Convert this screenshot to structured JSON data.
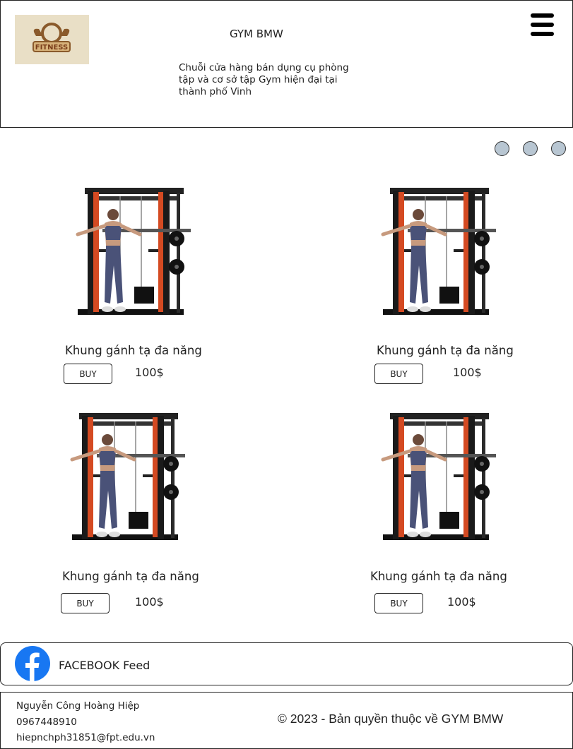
{
  "header": {
    "logo_text": "FITNESS",
    "brand": "GYM BMW",
    "description": "Chuỗi cửa hàng bán dụng cụ phòng tập và cơ sở tập Gym hiện đại tại thành phố Vinh"
  },
  "slider": {
    "dots": 3
  },
  "products": [
    {
      "name": "Khung gánh tạ đa năng",
      "buy_label": "BUY",
      "price": "100$"
    },
    {
      "name": "Khung gánh tạ đa năng",
      "buy_label": "BUY",
      "price": "100$"
    },
    {
      "name": "Khung gánh tạ đa năng",
      "buy_label": "BUY",
      "price": "100$"
    },
    {
      "name": "Khung gánh tạ đa năng",
      "buy_label": "BUY",
      "price": "100$"
    }
  ],
  "facebook": {
    "label": "FACEBOOK Feed"
  },
  "footer": {
    "name": "Nguyễn Công Hoàng Hiệp",
    "phone": "0967448910",
    "email": "hiepnchph31851@fpt.edu.vn",
    "copyright": "© 2023 - Bản quyền thuộc về GYM BMW"
  },
  "colors": {
    "accent_blue": "#1877f2",
    "frame_orange": "#d44a22",
    "dot_fill": "#b8c6d2"
  }
}
